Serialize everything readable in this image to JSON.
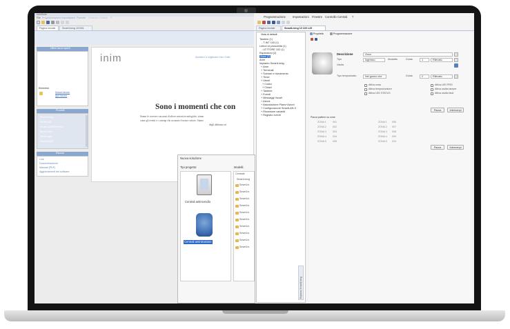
{
  "left_app": {
    "title_text": "InimSuite",
    "menu": [
      "File",
      "Programmazione",
      "Impostazioni",
      "Finestre",
      "Controllo Centrali",
      "?"
    ],
    "tabs": [
      "Pagina Iniziale",
      "SmartLiving 10100L"
    ],
    "sidebar": {
      "header1": "Ultimi lavori aperti",
      "recent_label": "Elemento",
      "recent_links": [
        "Nuovo lavoro",
        "Apri lavoro"
      ],
      "header2": "Prodotti",
      "products": [
        "SmartLiving",
        "SmartLAN",
        "SmartLAN/EthernetG",
        "SmartVoice",
        "SmartLight",
        "Nexus/GSM"
      ],
      "header3": "Risorse",
      "resources": [
        "Link",
        "Documentazione",
        "Manuali (PDF)",
        "Aggiornamenti del software"
      ]
    },
    "welcome": {
      "logo": "inim",
      "top_link": "Aiutateci a migliorare Inim Suite",
      "headline": "Sono i momenti che con",
      "body1": "Siamo fe ricevere carcaiusi di altere sezioni tecnologiche, siamo",
      "body2": "come gli eventi e i casetup che accanute il nostro settore. Siamo",
      "body3": "degli abbiamo ori"
    },
    "dialog": {
      "title": "Nuova soluzione",
      "col_left": "Tipi progetto:",
      "col_right": "Modelli:",
      "type1": "Centrali antincendio",
      "type2": "Centrali antintrusione",
      "models_header": "Centrale",
      "models": [
        "SmartLiving",
        "SmartLiv",
        "SmartLiv",
        "SmartLiv",
        "SmartLiv",
        "SmartLiv",
        "SmartLiv",
        "SmartLiv",
        "SmartLiv",
        "SmartLiv",
        "SmartLiv"
      ]
    }
  },
  "right_app": {
    "menu": [
      "Programmazione",
      "Impostazioni",
      "Finestre",
      "Controllo Centrali",
      "?"
    ],
    "tabs": [
      "Pagina Iniziale",
      "SmartLiving 10 100 L25"
    ],
    "tree_header": "Vista di default",
    "tree": [
      "Tastiere (1)",
      "- T-INT 100 (1)",
      "Lettori di prossimità (1)",
      "- LETTORE 102 (1)",
      "Espansioni (2)",
      "Zone (7)",
      "Aree",
      "Impianto SmartLiving",
      "+ Aree",
      "+ Terminali",
      "+ Scenari e ricevimento",
      "+ Timer",
      "+ Utenti",
      "  + Codici",
      "  + Chiavi",
      "+ Tastiere",
      "+ Eventi",
      "+ Messaggi Vocali",
      "+ Azioni",
      "+ Associazione Plans+Azioni",
      "+ Configurazione SmartLAN G",
      "+ Risorsione variabili",
      "+ Registro eventi"
    ],
    "side_tab": "Esplora SmartLiving",
    "prop_tabs": [
      "Proprietà",
      "Programmazione"
    ],
    "form": {
      "descr_label": "Descrizione",
      "descr_value": "Zona",
      "type_label": "Tipo",
      "type_value": "Ingresso",
      "mode_label": "Modalità",
      "mode_value": "Guida",
      "mode_num": "1",
      "mode_sel": "Rilevato",
      "out_label": "Uscita",
      "time_label": "Tipo temporizzato",
      "time_value": "Nel giorno che",
      "time_mode": "Guida",
      "time_num": "2",
      "time_sel": "Rilevato",
      "checks_left": [
        "Attiva zona",
        "Attiva temporizzatore",
        "Attiva LED STATUS"
      ],
      "checks_right": [
        "Attiva LED PRG",
        "Attiva uscita tamper",
        "Attiva uscita fault"
      ],
      "btn1": "Pacca",
      "btn2": "Interrompi"
    },
    "zone_list": {
      "header": "Pacca pattern su zone",
      "rows": [
        [
          "ZONA 1",
          "001",
          "ZONA 1",
          "006"
        ],
        [
          "ZONA 2",
          "002",
          "ZONA 2",
          "007"
        ],
        [
          "ZONA 3",
          "003",
          "ZONA 3",
          "008"
        ],
        [
          "ZONA 4",
          "004",
          "ZONA 4",
          "009"
        ],
        [
          "ZONA 5",
          "005",
          "ZONA 5",
          "010"
        ]
      ],
      "btn1": "Pacca",
      "btn2": "Interrompi"
    }
  }
}
